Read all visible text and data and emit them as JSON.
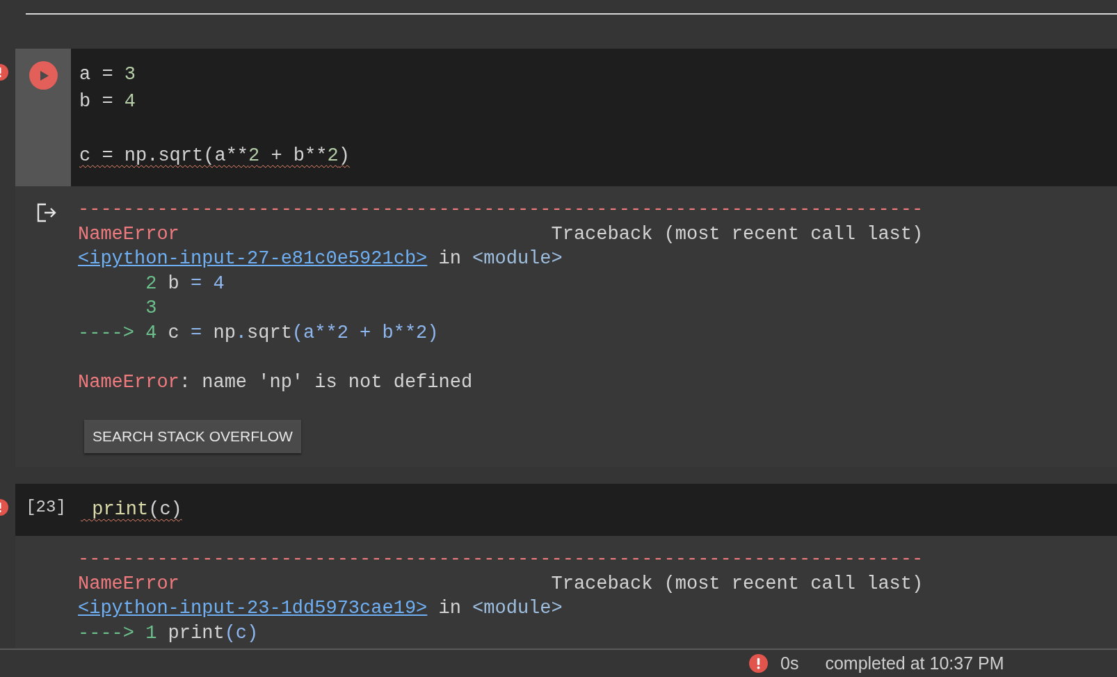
{
  "cells": [
    {
      "kind": "run",
      "error": true,
      "code": [
        {
          "kind": "code",
          "underlined": false,
          "tokens": [
            {
              "text": "a = ",
              "kind": "plain"
            },
            {
              "text": "3",
              "kind": "number"
            }
          ]
        },
        {
          "kind": "code",
          "underlined": false,
          "tokens": [
            {
              "text": "b = ",
              "kind": "plain"
            },
            {
              "text": "4",
              "kind": "number"
            }
          ]
        },
        {
          "kind": "blank"
        },
        {
          "kind": "code",
          "underlined": true,
          "tokens": [
            {
              "text": "c = np.sqrt(a**",
              "kind": "plain"
            },
            {
              "text": "2",
              "kind": "number"
            },
            {
              "text": " + b**",
              "kind": "plain"
            },
            {
              "text": "2",
              "kind": "number"
            },
            {
              "text": ")",
              "kind": "plain"
            }
          ]
        }
      ],
      "output": {
        "icon": true,
        "button": "SEARCH STACK OVERFLOW",
        "lines": [
          {
            "kind": "code",
            "tokens": [
              {
                "text": "---------------------------------------------------------------------------",
                "kind": "error"
              }
            ]
          },
          {
            "kind": "code",
            "tokens": [
              {
                "text": "NameError",
                "kind": "error"
              },
              {
                "text": "                                 Traceback (most recent call last)",
                "kind": "plain"
              }
            ]
          },
          {
            "kind": "code",
            "tokens": [
              {
                "text": "<ipython-input-27-e81c0e5921cb>",
                "kind": "link"
              },
              {
                "text": " in ",
                "kind": "plain"
              },
              {
                "text": "<module>",
                "kind": "module"
              }
            ]
          },
          {
            "kind": "code",
            "tokens": [
              {
                "text": "      2",
                "kind": "lineno"
              },
              {
                "text": " b ",
                "kind": "plain"
              },
              {
                "text": "=",
                "kind": "blue"
              },
              {
                "text": " 4",
                "kind": "blue"
              }
            ]
          },
          {
            "kind": "code",
            "tokens": [
              {
                "text": "      3",
                "kind": "lineno"
              }
            ]
          },
          {
            "kind": "code",
            "tokens": [
              {
                "text": "----> 4",
                "kind": "lineno"
              },
              {
                "text": " c ",
                "kind": "plain"
              },
              {
                "text": "=",
                "kind": "blue"
              },
              {
                "text": " np",
                "kind": "plain"
              },
              {
                "text": ".",
                "kind": "blue"
              },
              {
                "text": "sqrt",
                "kind": "plain"
              },
              {
                "text": "(a**2 + b**2)",
                "kind": "blue"
              }
            ]
          },
          {
            "kind": "blank"
          },
          {
            "kind": "code",
            "tokens": [
              {
                "text": "NameError",
                "kind": "error"
              },
              {
                "text": ": name 'np' is not defined",
                "kind": "plain"
              }
            ]
          }
        ]
      }
    },
    {
      "kind": "count",
      "error": true,
      "count": "[23]",
      "code": [
        {
          "kind": "code",
          "underlined": true,
          "tokens": [
            {
              "text": " print",
              "kind": "func"
            },
            {
              "text": "(c)",
              "kind": "plain"
            }
          ]
        }
      ],
      "output": {
        "lines": [
          {
            "kind": "code",
            "tokens": [
              {
                "text": "---------------------------------------------------------------------------",
                "kind": "error"
              }
            ]
          },
          {
            "kind": "code",
            "tokens": [
              {
                "text": "NameError",
                "kind": "error"
              },
              {
                "text": "                                 Traceback (most recent call last)",
                "kind": "plain"
              }
            ]
          },
          {
            "kind": "code",
            "tokens": [
              {
                "text": "<ipython-input-23-1dd5973cae19>",
                "kind": "link"
              },
              {
                "text": " in ",
                "kind": "plain"
              },
              {
                "text": "<module>",
                "kind": "module"
              }
            ]
          },
          {
            "kind": "code",
            "tokens": [
              {
                "text": "----> 1",
                "kind": "lineno"
              },
              {
                "text": " print",
                "kind": "plain"
              },
              {
                "text": "(c)",
                "kind": "blue"
              }
            ]
          }
        ]
      }
    }
  ],
  "status_bar": {
    "error": true,
    "duration": "0s",
    "message": "completed at 10:37 PM"
  }
}
